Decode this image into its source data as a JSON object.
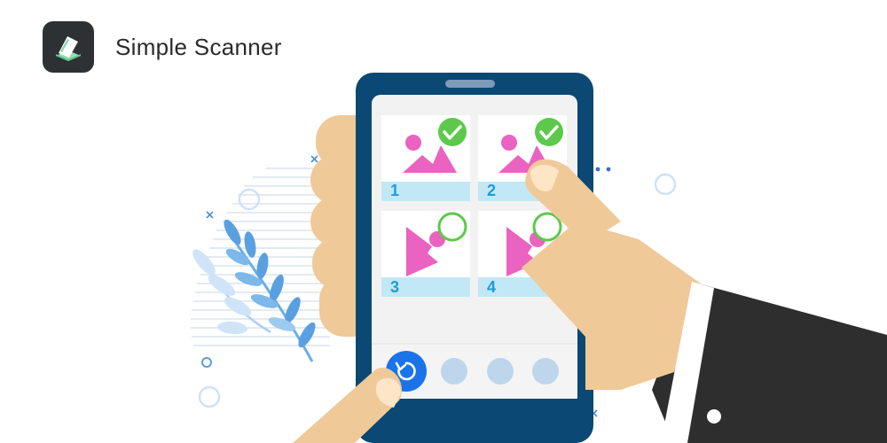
{
  "app": {
    "title": "Simple Scanner",
    "icon": "scanner-icon"
  },
  "pages": [
    {
      "number": "1",
      "selected": true
    },
    {
      "number": "2",
      "selected": true
    },
    {
      "number": "3",
      "selected": false
    },
    {
      "number": "4",
      "selected": false
    }
  ],
  "toolbar": {
    "buttons": [
      "rotate-icon",
      "dot",
      "dot",
      "dot"
    ]
  },
  "colors": {
    "phone_body": "#0b4873",
    "screen": "#f2f2f2",
    "check_green": "#5cc94b",
    "picture_pink": "#ea63c1",
    "label_blue": "#c2e8f5",
    "number_blue": "#1e9bd7",
    "rotate_button": "#1a73e8",
    "skin": "#f0c999",
    "sleeve": "#2e2e2e"
  }
}
